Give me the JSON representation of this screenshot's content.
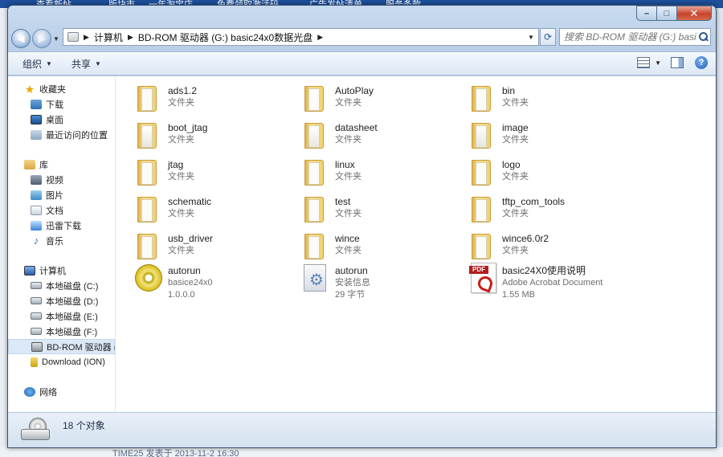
{
  "background": {
    "top_links": [
      "查看新帖",
      "版块市",
      "一年淘宝店",
      "免费领取激活码",
      "广告发帖清单",
      "服务条款"
    ],
    "footer_text": "TIME25 发表于 2013-11-2 16:30"
  },
  "window": {
    "controls": {
      "minimize": "–",
      "maximize": "□",
      "close": "✕"
    }
  },
  "address": {
    "crumbs": [
      "计算机",
      "BD-ROM 驱动器 (G:) basic24x0数据光盘"
    ],
    "search_placeholder": "搜索 BD-ROM 驱动器 (G:) basic24x..."
  },
  "toolbar": {
    "organize": "组织",
    "share": "共享"
  },
  "sidebar": {
    "favorites": {
      "title": "收藏夹",
      "items": [
        "下载",
        "桌面",
        "最近访问的位置"
      ]
    },
    "libraries": {
      "title": "库",
      "items": [
        "视频",
        "图片",
        "文档",
        "迅雷下载",
        "音乐"
      ]
    },
    "computer": {
      "title": "计算机",
      "items": [
        "本地磁盘 (C:)",
        "本地磁盘 (D:)",
        "本地磁盘 (E:)",
        "本地磁盘 (F:)",
        "BD-ROM 驱动器 (G",
        "Download (ION)"
      ]
    },
    "network": {
      "title": "网络"
    }
  },
  "files": [
    {
      "name": "ads1.2",
      "line2": "文件夹",
      "icon": "folder-icon"
    },
    {
      "name": "AutoPlay",
      "line2": "文件夹",
      "icon": "folder-icon"
    },
    {
      "name": "bin",
      "line2": "文件夹",
      "icon": "folder-icon"
    },
    {
      "name": "boot_jtag",
      "line2": "文件夹",
      "icon": "folder-icon"
    },
    {
      "name": "datasheet",
      "line2": "文件夹",
      "icon": "folder-icon"
    },
    {
      "name": "image",
      "line2": "文件夹",
      "icon": "folder-icon"
    },
    {
      "name": "jtag",
      "line2": "文件夹",
      "icon": "folder-icon"
    },
    {
      "name": "linux",
      "line2": "文件夹",
      "icon": "folder-icon"
    },
    {
      "name": "logo",
      "line2": "文件夹",
      "icon": "folder-icon"
    },
    {
      "name": "schematic",
      "line2": "文件夹",
      "icon": "folder-icon"
    },
    {
      "name": "test",
      "line2": "文件夹",
      "icon": "folder-icon"
    },
    {
      "name": "tftp_com_tools",
      "line2": "文件夹",
      "icon": "folder-icon"
    },
    {
      "name": "usb_driver",
      "line2": "文件夹",
      "icon": "folder-icon"
    },
    {
      "name": "wince",
      "line2": "文件夹",
      "icon": "folder-icon"
    },
    {
      "name": "wince6.0r2",
      "line2": "文件夹",
      "icon": "folder-icon"
    },
    {
      "name": "autorun",
      "line2": "basice24x0",
      "line3": "1.0.0.0",
      "icon": "cd-autorun-icon"
    },
    {
      "name": "autorun",
      "line2": "安装信息",
      "line3": "29 字节",
      "icon": "setup-info-icon"
    },
    {
      "name": "basic24X0使用说明",
      "line2": "Adobe Acrobat Document",
      "line3": "1.55 MB",
      "icon": "pdf-icon"
    }
  ],
  "status": {
    "count_text": "18 个对象"
  }
}
